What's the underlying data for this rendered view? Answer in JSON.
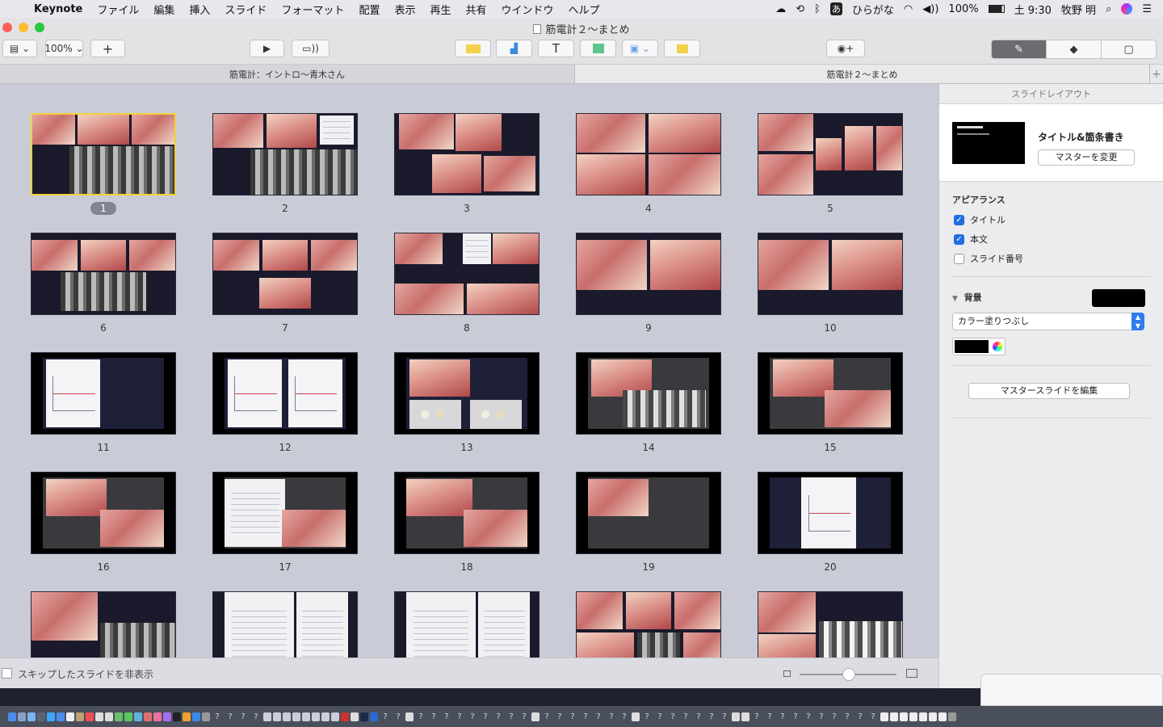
{
  "menubar": {
    "app_name": "Keynote",
    "items": [
      "ファイル",
      "編集",
      "挿入",
      "スライド",
      "フォーマット",
      "配置",
      "表示",
      "再生",
      "共有",
      "ウインドウ",
      "ヘルプ"
    ],
    "input_mode": "ひらがな",
    "battery": "100%",
    "clock": "土 9:30",
    "user": "牧野 明"
  },
  "window": {
    "title": "筋電計２〜まとめ",
    "zoom": "100%"
  },
  "tabs": [
    {
      "label": "筋電計：イントロ〜青木さん"
    },
    {
      "label": "筋電計２〜まとめ"
    }
  ],
  "slides": [
    {
      "number": "1"
    },
    {
      "number": "2"
    },
    {
      "number": "3"
    },
    {
      "number": "4"
    },
    {
      "number": "5"
    },
    {
      "number": "6"
    },
    {
      "number": "7"
    },
    {
      "number": "8"
    },
    {
      "number": "9"
    },
    {
      "number": "10"
    },
    {
      "number": "11"
    },
    {
      "number": "12"
    },
    {
      "number": "13"
    },
    {
      "number": "14"
    },
    {
      "number": "15"
    },
    {
      "number": "16"
    },
    {
      "number": "17"
    },
    {
      "number": "18"
    },
    {
      "number": "19"
    },
    {
      "number": "20"
    },
    {
      "number": ""
    },
    {
      "number": ""
    },
    {
      "number": ""
    },
    {
      "number": ""
    },
    {
      "number": ""
    }
  ],
  "selected_slide": "1",
  "footer": {
    "hide_skipped_label": "スキップしたスライドを非表示"
  },
  "inspector": {
    "header": "スライドレイアウト",
    "layout_name": "タイトル&箇条書き",
    "change_master_button": "マスターを変更",
    "appearance_title": "アピアランス",
    "checkboxes": [
      {
        "label": "タイトル",
        "checked": true
      },
      {
        "label": "本文",
        "checked": true
      },
      {
        "label": "スライド番号",
        "checked": false
      }
    ],
    "background_title": "背景",
    "background_color": "#000000",
    "fill_type": "カラー塗りつぶし",
    "edit_master_button": "マスタースライドを編集"
  }
}
